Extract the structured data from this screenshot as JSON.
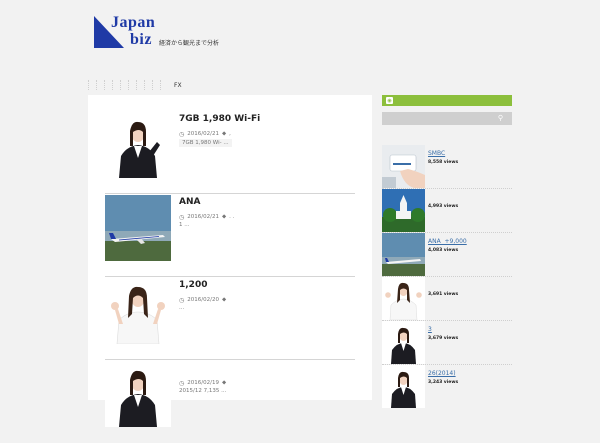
{
  "site": {
    "logo_line1": "Japan",
    "logo_line2": "biz",
    "tagline": "経済から観光まで分析",
    "brand_color": "#1f3aa6"
  },
  "nav": {
    "label": "FX"
  },
  "posts": [
    {
      "title": "7GB 1,980 Wi-Fi",
      "date": "2016/02/21",
      "tags": ",",
      "excerpt": "7GB 1,980 Wi- ..."
    },
    {
      "title": "ANA",
      "date": "2016/02/21",
      "tags": ". .",
      "excerpt": "1 ..."
    },
    {
      "title": "1,200",
      "date": "2016/02/20",
      "tags": "",
      "excerpt": "..."
    },
    {
      "title": "",
      "date": "2016/02/19",
      "tags": "",
      "excerpt": "2015/12    7,135 ..."
    }
  ],
  "sidebar": {
    "accent_color": "#8cbf3c",
    "ranking": [
      {
        "title": "SMBC",
        "views": "8,558 views"
      },
      {
        "title": "",
        "views": "4,993 views"
      },
      {
        "title": "ANA  +9,000",
        "views": "4,083 views"
      },
      {
        "title": "",
        "views": "3,691 views"
      },
      {
        "title": "3",
        "views": "3,679 views"
      },
      {
        "title": "26(2014)",
        "views": "3,243 views"
      }
    ]
  }
}
